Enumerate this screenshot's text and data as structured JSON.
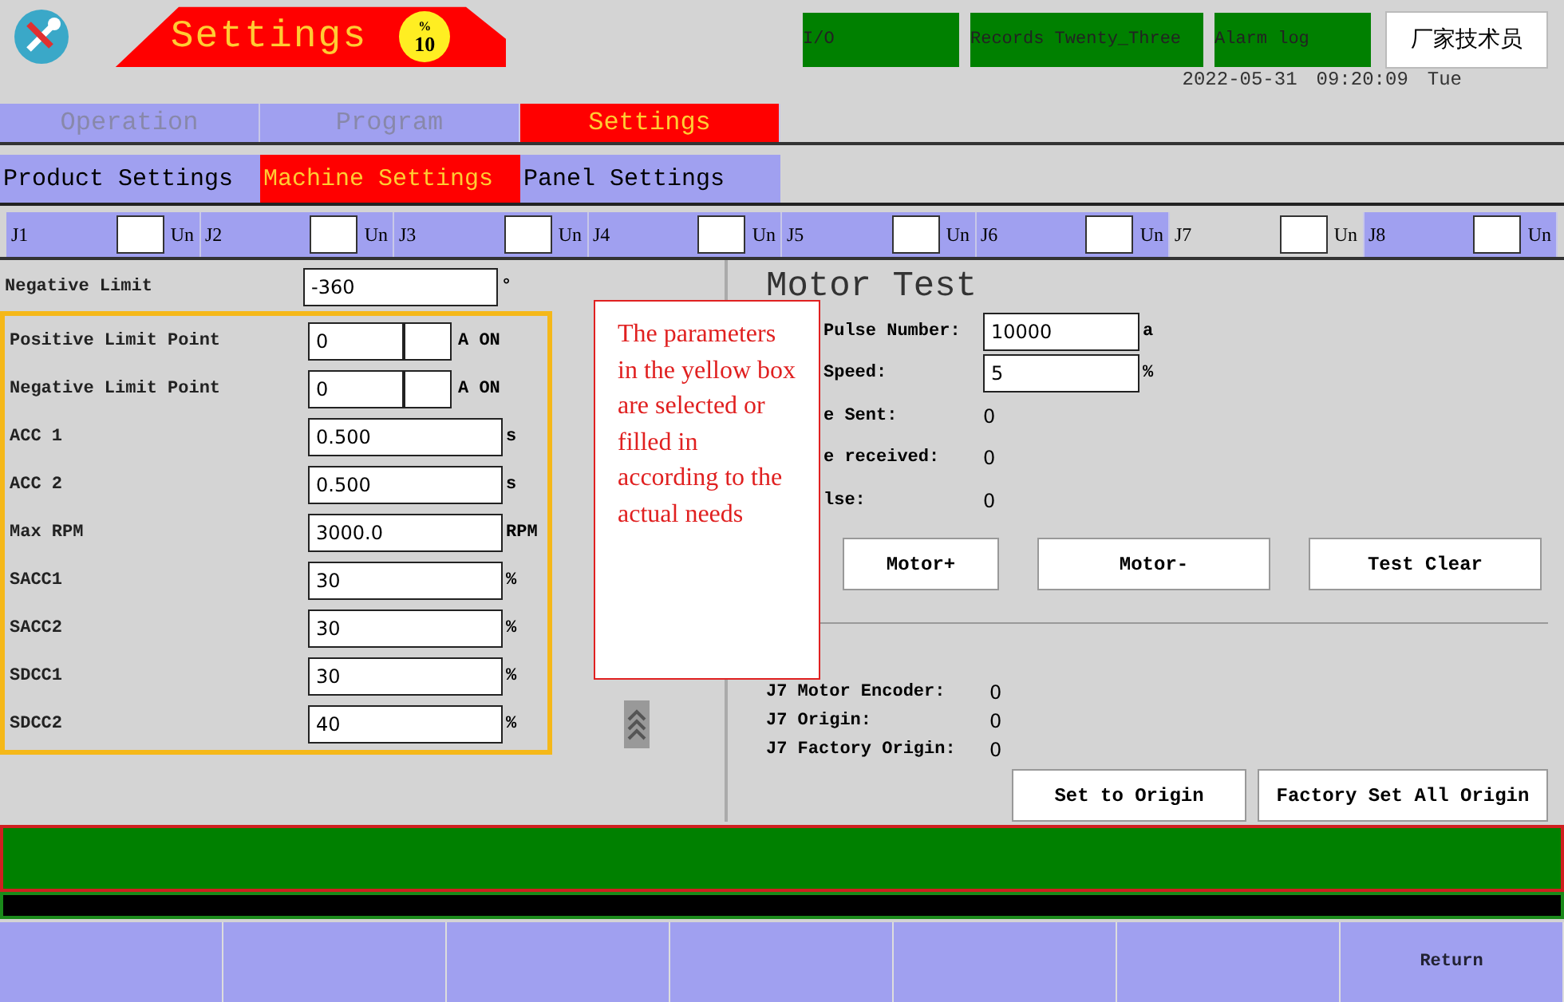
{
  "header": {
    "title": "Settings",
    "speed_badge": {
      "unit": "%",
      "value": "10"
    },
    "indicators": [
      {
        "label": "I/O"
      },
      {
        "label": "Records Twenty_Three"
      },
      {
        "label": "Alarm log"
      }
    ],
    "user_button": "厂家技术员",
    "datetime": {
      "date": "2022-05-31",
      "time": "09:20:09",
      "weekday": "Tue"
    }
  },
  "main_tabs": [
    {
      "label": "Operation",
      "selected": false,
      "disabled": true
    },
    {
      "label": "Program",
      "selected": false,
      "disabled": true
    },
    {
      "label": "Settings",
      "selected": true,
      "disabled": false
    }
  ],
  "sub_tabs": [
    {
      "label": "Product Settings",
      "selected": false
    },
    {
      "label": "Machine Settings",
      "selected": true
    },
    {
      "label": "Panel Settings",
      "selected": false
    }
  ],
  "joints": [
    {
      "label": "J1",
      "unit": "Un",
      "highlighted": true
    },
    {
      "label": "J2",
      "unit": "Un",
      "highlighted": true
    },
    {
      "label": "J3",
      "unit": "Un",
      "highlighted": true
    },
    {
      "label": "J4",
      "unit": "Un",
      "highlighted": true
    },
    {
      "label": "J5",
      "unit": "Un",
      "highlighted": true
    },
    {
      "label": "J6",
      "unit": "Un",
      "highlighted": true
    },
    {
      "label": "J7",
      "unit": "Un",
      "highlighted": false
    },
    {
      "label": "J8",
      "unit": "Un",
      "highlighted": true
    }
  ],
  "parameters": [
    {
      "label": "Negative Limit",
      "value": "-360",
      "unit": "°",
      "kind": "single"
    }
  ],
  "boxed_parameters": [
    {
      "label": "Positive Limit Point",
      "value": "0",
      "unit": "A ON",
      "kind": "split"
    },
    {
      "label": "Negative Limit Point",
      "value": "0",
      "unit": "A ON",
      "kind": "split"
    },
    {
      "label": "ACC 1",
      "value": "0.500",
      "unit": "s",
      "kind": "single"
    },
    {
      "label": "ACC 2",
      "value": "0.500",
      "unit": "s",
      "kind": "single"
    },
    {
      "label": "Max RPM",
      "value": "3000.0",
      "unit": "RPM",
      "kind": "single"
    },
    {
      "label": "SACC1",
      "value": "30",
      "unit": "%",
      "kind": "single"
    },
    {
      "label": "SACC2",
      "value": "30",
      "unit": "%",
      "kind": "single"
    },
    {
      "label": "SDCC1",
      "value": "30",
      "unit": "%",
      "kind": "single"
    },
    {
      "label": "SDCC2",
      "value": "40",
      "unit": "%",
      "kind": "single"
    }
  ],
  "note": "The parameters in the yellow box are selected or filled in according to the actual needs",
  "motor_test": {
    "title": "Motor Test",
    "rows": [
      {
        "label": "Pulse Number:",
        "value": "10000",
        "unit": "a",
        "kind": "input"
      },
      {
        "label": "Speed:",
        "value": "5",
        "unit": "%",
        "kind": "input"
      },
      {
        "label": "e Sent:",
        "value": "0",
        "kind": "reading"
      },
      {
        "label": "e received:",
        "value": "0",
        "kind": "reading"
      },
      {
        "label": "lse:",
        "value": "0",
        "kind": "reading"
      }
    ],
    "buttons": [
      "Motor+",
      "Motor-",
      "Test Clear"
    ],
    "encoder": [
      {
        "label": "J7 Motor Encoder:",
        "value": "0"
      },
      {
        "label": "J7 Origin:",
        "value": "0"
      },
      {
        "label": "J7 Factory Origin:",
        "value": "0"
      }
    ],
    "origin_buttons": [
      "Set to Origin",
      "Factory Set All Origin"
    ]
  },
  "bottom_keys": [
    {
      "label": "Return"
    }
  ]
}
